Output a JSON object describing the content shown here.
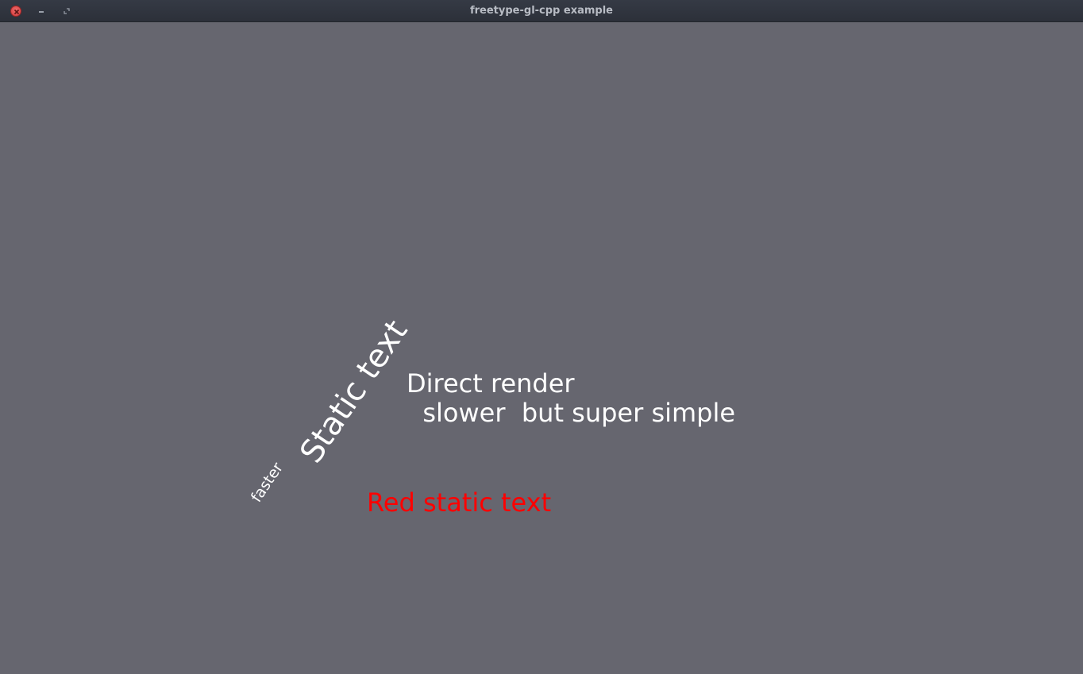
{
  "window": {
    "title": "freetype-gl-cpp example",
    "controls": {
      "close_icon": "close-icon",
      "minimize_icon": "minimize-icon",
      "maximize_icon": "maximize-icon"
    }
  },
  "scene": {
    "background_color": "#66666f",
    "direct_render": {
      "line1": "Direct render",
      "line2": "  slower  but super simple",
      "color": "#ffffff"
    },
    "rotated_static": {
      "large": "Static text",
      "small": "faster",
      "color": "#ffffff"
    },
    "red_static": {
      "text": "Red static text",
      "color": "#ff0000"
    }
  }
}
